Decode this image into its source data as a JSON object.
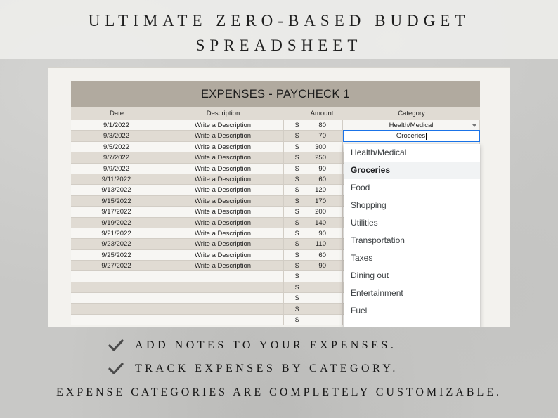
{
  "banner": {
    "line1": "ULTIMATE ZERO-BASED BUDGET",
    "line2": "SPREADSHEET"
  },
  "sheet": {
    "title": "EXPENSES - PAYCHECK 1",
    "headers": {
      "date": "Date",
      "description": "Description",
      "amount": "Amount",
      "category": "Category"
    },
    "currency": "$",
    "rows": [
      {
        "date": "9/1/2022",
        "description": "Write a Description",
        "amount": "80",
        "category": "Health/Medical"
      },
      {
        "date": "9/3/2022",
        "description": "Write a Description",
        "amount": "70",
        "category": "Groceries"
      },
      {
        "date": "9/5/2022",
        "description": "Write a Description",
        "amount": "300",
        "category": ""
      },
      {
        "date": "9/7/2022",
        "description": "Write a Description",
        "amount": "250",
        "category": ""
      },
      {
        "date": "9/9/2022",
        "description": "Write a Description",
        "amount": "90",
        "category": ""
      },
      {
        "date": "9/11/2022",
        "description": "Write a Description",
        "amount": "60",
        "category": ""
      },
      {
        "date": "9/13/2022",
        "description": "Write a Description",
        "amount": "120",
        "category": ""
      },
      {
        "date": "9/15/2022",
        "description": "Write a Description",
        "amount": "170",
        "category": ""
      },
      {
        "date": "9/17/2022",
        "description": "Write a Description",
        "amount": "200",
        "category": ""
      },
      {
        "date": "9/19/2022",
        "description": "Write a Description",
        "amount": "140",
        "category": ""
      },
      {
        "date": "9/21/2022",
        "description": "Write a Description",
        "amount": "90",
        "category": ""
      },
      {
        "date": "9/23/2022",
        "description": "Write a Description",
        "amount": "110",
        "category": ""
      },
      {
        "date": "9/25/2022",
        "description": "Write a Description",
        "amount": "60",
        "category": ""
      },
      {
        "date": "9/27/2022",
        "description": "Write a Description",
        "amount": "90",
        "category": ""
      },
      {
        "date": "",
        "description": "",
        "amount": "",
        "category": ""
      },
      {
        "date": "",
        "description": "",
        "amount": "",
        "category": ""
      },
      {
        "date": "",
        "description": "",
        "amount": "",
        "category": ""
      },
      {
        "date": "",
        "description": "",
        "amount": "",
        "category": ""
      },
      {
        "date": "",
        "description": "",
        "amount": "",
        "category": ""
      }
    ],
    "dropdown": {
      "selected": "Groceries",
      "options": [
        "Health/Medical",
        "Groceries",
        "Food",
        "Shopping",
        "Utilities",
        "Transportation",
        "Taxes",
        "Dining out",
        "Entertainment",
        "Fuel"
      ]
    }
  },
  "features": [
    "ADD NOTES TO YOUR EXPENSES.",
    "TRACK EXPENSES BY CATEGORY.",
    "EXPENSE CATEGORIES ARE COMPLETELY CUSTOMIZABLE."
  ],
  "icons": {
    "check": "check-icon"
  },
  "colors": {
    "header_fill": "#b1aa9f",
    "row_alt": "#e0dbd3",
    "focus_blue": "#1a73e8"
  }
}
